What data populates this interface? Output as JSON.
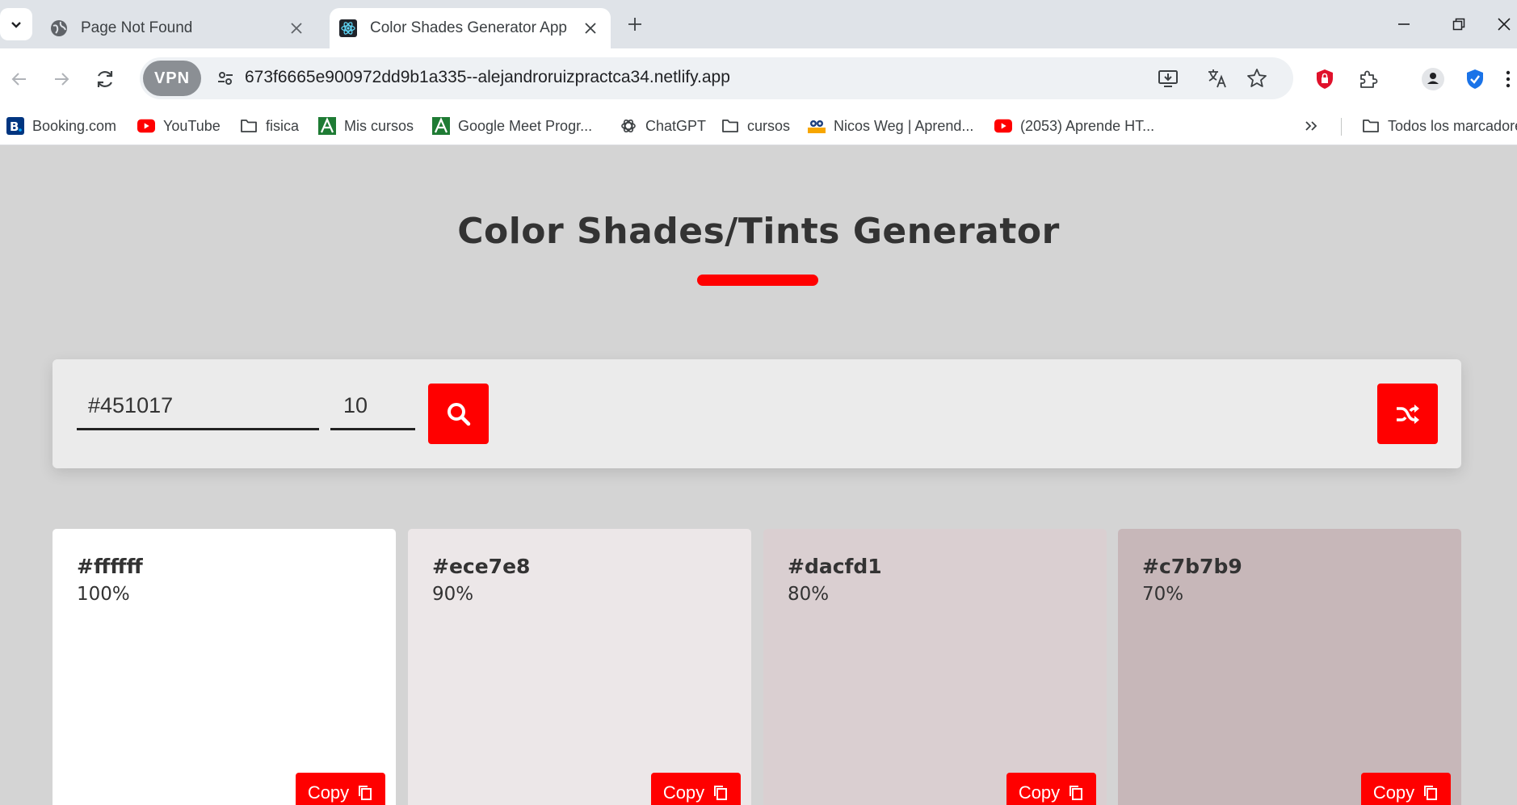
{
  "browser": {
    "tabs": [
      {
        "title": "Page Not Found",
        "active": false,
        "favicon": "globe-icon"
      },
      {
        "title": "Color Shades Generator App",
        "active": true,
        "favicon": "react-icon"
      }
    ],
    "address": {
      "vpn_label": "VPN",
      "url": "673f6665e900972dd9b1a335--alejandroruizpractca34.netlify.app"
    },
    "bookmarks": [
      {
        "label": "Booking.com",
        "icon": "booking-icon"
      },
      {
        "label": "YouTube",
        "icon": "youtube-icon"
      },
      {
        "label": "fisica",
        "icon": "folder-icon"
      },
      {
        "label": "Mis cursos",
        "icon": "academy-icon"
      },
      {
        "label": "Google Meet Progr...",
        "icon": "academy-icon"
      },
      {
        "label": "ChatGPT",
        "icon": "chatgpt-icon"
      },
      {
        "label": "cursos",
        "icon": "folder-icon"
      },
      {
        "label": "Nicos Weg | Aprend...",
        "icon": "dw-icon"
      },
      {
        "label": "(2053) Aprende HT...",
        "icon": "youtube-icon"
      }
    ],
    "all_bookmarks_label": "Todos los marcadores"
  },
  "app": {
    "title": "Color Shades/Tints Generator",
    "accent_color": "#ff0000",
    "form": {
      "color_value": "#451017",
      "count_value": "10"
    },
    "copy_label": "Copy",
    "shades": [
      {
        "hex": "#ffffff",
        "percent": "100%",
        "bg": "#ffffff"
      },
      {
        "hex": "#ece7e8",
        "percent": "90%",
        "bg": "#ece7e8"
      },
      {
        "hex": "#dacfd1",
        "percent": "80%",
        "bg": "#dacfd1"
      },
      {
        "hex": "#c7b7b9",
        "percent": "70%",
        "bg": "#c7b7b9"
      }
    ]
  }
}
